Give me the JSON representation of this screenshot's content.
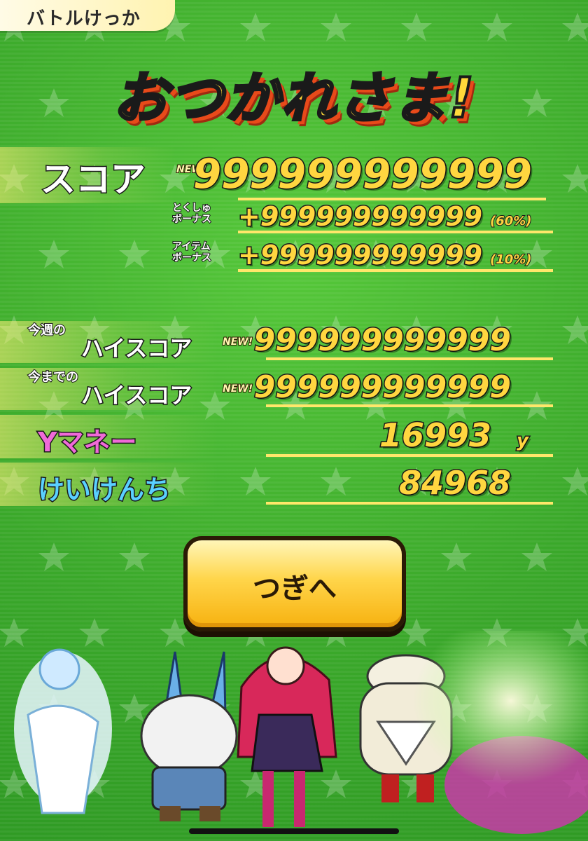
{
  "header": {
    "title": "バトルけっか"
  },
  "banner": {
    "text": "おつかれさま!"
  },
  "score": {
    "label": "スコア",
    "new_badge": "NEW!",
    "value": "999999999999",
    "bonus_special_label_1": "とくしゅ",
    "bonus_special_label_2": "ボーナス",
    "bonus_special_value": "+999999999999",
    "bonus_special_pct": "(60%)",
    "bonus_item_label_1": "アイテム",
    "bonus_item_label_2": "ボーナス",
    "bonus_item_value": "+999999999999",
    "bonus_item_pct": "(10%)"
  },
  "weekly_high": {
    "label_small": "今週の",
    "label": "ハイスコア",
    "new_badge": "NEW!",
    "value": "999999999999"
  },
  "alltime_high": {
    "label_small": "今までの",
    "label": "ハイスコア",
    "new_badge": "NEW!",
    "value": "999999999999"
  },
  "ymoney": {
    "label": "Yマネー",
    "value": "16993",
    "unit": "y"
  },
  "exp": {
    "label": "けいけんち",
    "value": "84968"
  },
  "next_button": {
    "label": "つぎへ"
  },
  "colors": {
    "accent_yellow": "#ffd640",
    "bg_green": "#3fb02c",
    "ymoney_pink": "#f06ad8",
    "exp_blue": "#5ad0ff"
  }
}
